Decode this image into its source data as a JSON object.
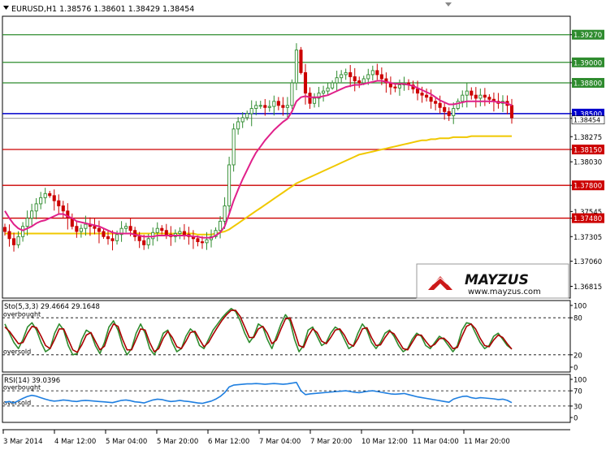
{
  "header": {
    "symbol_line": "EURUSD,H1  1.38576 1.38601 1.38429 1.38454"
  },
  "watermark": {
    "brand": "MAYZUS",
    "url": "www.mayzus.com"
  },
  "colors": {
    "green_line": "#2e8b2e",
    "red_line": "#cc0000",
    "blue_line": "#0000cc",
    "ma_fast": "#e0208a",
    "ma_slow": "#f0c800",
    "stoch_main": "#2e8b2e",
    "stoch_signal": "#aa0000",
    "rsi": "#1f7fe0"
  },
  "chart_data": [
    {
      "type": "candlestick",
      "title": "EURUSD,H1",
      "ohlc_last": {
        "open": 1.38576,
        "high": 1.38601,
        "low": 1.38429,
        "close": 1.38454
      },
      "ylim": [
        1.367,
        1.3945
      ],
      "y_ticks": [
        {
          "value": 1.3927,
          "label": "1.39270"
        },
        {
          "value": 1.39,
          "label": "1.39000"
        },
        {
          "value": 1.388,
          "label": "1.38800"
        },
        {
          "value": 1.385,
          "label": "1.38500"
        },
        {
          "value": 1.38454,
          "label": "1.38454"
        },
        {
          "value": 1.38275,
          "label": "1.38275"
        },
        {
          "value": 1.3815,
          "label": "1.38150"
        },
        {
          "value": 1.3803,
          "label": "1.38030"
        },
        {
          "value": 1.378,
          "label": "1.37800"
        },
        {
          "value": 1.37545,
          "label": "1.37545"
        },
        {
          "value": 1.3748,
          "label": "1.37480"
        },
        {
          "value": 1.373,
          "label": "1.37305"
        },
        {
          "value": 1.3706,
          "label": "1.37060"
        },
        {
          "value": 1.36815,
          "label": "1.36815"
        }
      ],
      "x_ticks": [
        "3 Mar 2014",
        "4 Mar 12:00",
        "5 Mar 04:00",
        "5 Mar 20:00",
        "6 Mar 12:00",
        "7 Mar 04:00",
        "7 Mar 20:00",
        "10 Mar 12:00",
        "11 Mar 04:00",
        "11 Mar 20:00"
      ],
      "horizontal_levels": [
        {
          "value": 1.3927,
          "label": "1.39270",
          "role": "resistance"
        },
        {
          "value": 1.39,
          "label": "1.39000",
          "role": "resistance"
        },
        {
          "value": 1.388,
          "label": "1.38800",
          "role": "resistance"
        },
        {
          "value": 1.385,
          "label": "1.38500",
          "role": "pivot"
        },
        {
          "value": 1.3815,
          "label": "1.38150",
          "role": "support"
        },
        {
          "value": 1.378,
          "label": "1.37800",
          "role": "support"
        },
        {
          "value": 1.3748,
          "label": "1.37480",
          "role": "support"
        }
      ],
      "close_series": [
        1.3735,
        1.3728,
        1.3722,
        1.373,
        1.374,
        1.3748,
        1.3755,
        1.3762,
        1.3768,
        1.3772,
        1.377,
        1.3765,
        1.376,
        1.3755,
        1.3748,
        1.374,
        1.3735,
        1.3738,
        1.3742,
        1.374,
        1.3738,
        1.3735,
        1.373,
        1.3728,
        1.3726,
        1.3732,
        1.3738,
        1.374,
        1.3736,
        1.373,
        1.3726,
        1.3722,
        1.3728,
        1.3734,
        1.3738,
        1.3736,
        1.3732,
        1.373,
        1.3733,
        1.3735,
        1.3732,
        1.373,
        1.3728,
        1.3725,
        1.3724,
        1.3727,
        1.373,
        1.3736,
        1.3745,
        1.376,
        1.38,
        1.3835,
        1.3842,
        1.3846,
        1.385,
        1.3855,
        1.3858,
        1.3858,
        1.3856,
        1.3857,
        1.3862,
        1.3858,
        1.3856,
        1.3858,
        1.388,
        1.3912,
        1.389,
        1.387,
        1.386,
        1.3865,
        1.387,
        1.3872,
        1.3875,
        1.388,
        1.3885,
        1.3888,
        1.389,
        1.3886,
        1.3882,
        1.388,
        1.3884,
        1.3888,
        1.3892,
        1.3888,
        1.3884,
        1.388,
        1.3876,
        1.3875,
        1.3878,
        1.388,
        1.3878,
        1.3874,
        1.387,
        1.3868,
        1.3866,
        1.3862,
        1.386,
        1.3856,
        1.3852,
        1.3848,
        1.3855,
        1.3862,
        1.3868,
        1.3872,
        1.3868,
        1.3865,
        1.3868,
        1.3866,
        1.3864,
        1.3862,
        1.386,
        1.3862,
        1.3858,
        1.3846
      ],
      "ma_fast": [
        1.3755,
        1.3748,
        1.3742,
        1.3738,
        1.3736,
        1.3738,
        1.374,
        1.3743,
        1.3745,
        1.3746,
        1.3748,
        1.375,
        1.3752,
        1.3752,
        1.375,
        1.3748,
        1.3745,
        1.3744,
        1.3743,
        1.3742,
        1.3741,
        1.374,
        1.3738,
        1.3736,
        1.3734,
        1.3733,
        1.3733,
        1.3733,
        1.3733,
        1.3732,
        1.3731,
        1.373,
        1.373,
        1.373,
        1.3731,
        1.3731,
        1.3731,
        1.3731,
        1.3731,
        1.3731,
        1.3731,
        1.3731,
        1.373,
        1.373,
        1.3729,
        1.3729,
        1.3729,
        1.3731,
        1.3734,
        1.374,
        1.3752,
        1.3765,
        1.3776,
        1.3786,
        1.3795,
        1.3804,
        1.3812,
        1.3818,
        1.3824,
        1.3829,
        1.3834,
        1.3838,
        1.3842,
        1.3845,
        1.3852,
        1.3862,
        1.3866,
        1.3867,
        1.3866,
        1.3866,
        1.3866,
        1.3867,
        1.3868,
        1.387,
        1.3872,
        1.3874,
        1.3876,
        1.3877,
        1.3878,
        1.3878,
        1.3879,
        1.388,
        1.3881,
        1.3882,
        1.3882,
        1.3881,
        1.388,
        1.3879,
        1.3879,
        1.3879,
        1.3878,
        1.3877,
        1.3875,
        1.3873,
        1.3871,
        1.3869,
        1.3866,
        1.3863,
        1.3861,
        1.3859,
        1.3859,
        1.386,
        1.3861,
        1.3862,
        1.3862,
        1.3862,
        1.3862,
        1.3862,
        1.3862,
        1.3862,
        1.3861,
        1.3861,
        1.386,
        1.3858
      ],
      "ma_slow": [
        1.3733,
        1.3733,
        1.3733,
        1.3733,
        1.3733,
        1.3733,
        1.3733,
        1.3733,
        1.3733,
        1.3733,
        1.3733,
        1.3733,
        1.3733,
        1.3733,
        1.3733,
        1.3733,
        1.3733,
        1.3733,
        1.3733,
        1.3733,
        1.3733,
        1.3733,
        1.3733,
        1.3733,
        1.3733,
        1.3733,
        1.3733,
        1.3733,
        1.3733,
        1.3733,
        1.3733,
        1.3733,
        1.3733,
        1.3733,
        1.3733,
        1.3733,
        1.3733,
        1.3733,
        1.3733,
        1.3733,
        1.3733,
        1.3733,
        1.3733,
        1.3732,
        1.3732,
        1.3732,
        1.3732,
        1.3733,
        1.3734,
        1.3735,
        1.3737,
        1.374,
        1.3743,
        1.3746,
        1.3749,
        1.3752,
        1.3755,
        1.3758,
        1.3761,
        1.3764,
        1.3767,
        1.377,
        1.3773,
        1.3776,
        1.3779,
        1.3782,
        1.3784,
        1.3786,
        1.3788,
        1.379,
        1.3792,
        1.3794,
        1.3796,
        1.3798,
        1.38,
        1.3802,
        1.3804,
        1.3806,
        1.3808,
        1.381,
        1.3811,
        1.3812,
        1.3813,
        1.3814,
        1.3815,
        1.3816,
        1.3817,
        1.3818,
        1.3819,
        1.382,
        1.3821,
        1.3822,
        1.3823,
        1.3824,
        1.3824,
        1.3825,
        1.3825,
        1.3826,
        1.3826,
        1.3826,
        1.3827,
        1.3827,
        1.3827,
        1.3827,
        1.3828,
        1.3828,
        1.3828,
        1.3828,
        1.3828,
        1.3828,
        1.3828,
        1.3828,
        1.3828,
        1.3828
      ]
    },
    {
      "type": "line",
      "title": "Sto(5,3,3) 29.4664 29.1648",
      "ylim": [
        0,
        100
      ],
      "levels": [
        {
          "value": 80,
          "label": "overbought"
        },
        {
          "value": 20,
          "label": "oversold"
        }
      ],
      "y_ticks": [
        "100",
        "80",
        "20",
        "0"
      ],
      "series": [
        {
          "name": "main",
          "values": [
            70,
            55,
            40,
            30,
            45,
            65,
            72,
            60,
            40,
            25,
            30,
            55,
            70,
            60,
            35,
            20,
            22,
            45,
            60,
            55,
            35,
            22,
            40,
            65,
            75,
            60,
            35,
            20,
            30,
            55,
            70,
            55,
            30,
            20,
            35,
            55,
            60,
            40,
            25,
            30,
            50,
            62,
            55,
            35,
            30,
            45,
            60,
            70,
            80,
            88,
            95,
            90,
            75,
            55,
            40,
            50,
            70,
            65,
            45,
            30,
            50,
            70,
            85,
            75,
            45,
            25,
            35,
            60,
            65,
            50,
            35,
            40,
            55,
            65,
            60,
            45,
            30,
            35,
            55,
            70,
            60,
            40,
            30,
            40,
            55,
            60,
            50,
            35,
            25,
            30,
            45,
            55,
            50,
            35,
            30,
            40,
            50,
            45,
            35,
            25,
            35,
            60,
            72,
            70,
            55,
            40,
            30,
            35,
            50,
            55,
            45,
            35,
            29.4664
          ]
        },
        {
          "name": "signal",
          "values": [
            65,
            58,
            48,
            38,
            40,
            55,
            66,
            64,
            50,
            35,
            30,
            45,
            62,
            62,
            45,
            28,
            24,
            36,
            52,
            56,
            42,
            28,
            34,
            55,
            70,
            66,
            45,
            28,
            28,
            45,
            62,
            60,
            40,
            25,
            30,
            47,
            58,
            48,
            33,
            30,
            42,
            56,
            58,
            45,
            33,
            40,
            53,
            65,
            76,
            85,
            92,
            92,
            82,
            65,
            48,
            48,
            62,
            66,
            55,
            38,
            44,
            62,
            78,
            80,
            58,
            35,
            32,
            50,
            62,
            56,
            42,
            38,
            48,
            60,
            62,
            52,
            38,
            34,
            46,
            62,
            64,
            48,
            35,
            36,
            48,
            58,
            54,
            42,
            30,
            28,
            40,
            52,
            52,
            42,
            33,
            37,
            46,
            47,
            40,
            30,
            32,
            50,
            66,
            70,
            62,
            47,
            35,
            33,
            44,
            52,
            48,
            38,
            29.1648
          ]
        }
      ]
    },
    {
      "type": "line",
      "title": "RSI(14) 39.0396",
      "ylim": [
        0,
        100
      ],
      "levels": [
        {
          "value": 70,
          "label": "overbought"
        },
        {
          "value": 30,
          "label": "oversold"
        }
      ],
      "y_ticks": [
        "100",
        "70",
        "30",
        "0"
      ],
      "series": [
        {
          "name": "RSI",
          "values": [
            40,
            42,
            38,
            44,
            50,
            55,
            58,
            56,
            52,
            48,
            45,
            43,
            44,
            46,
            45,
            43,
            42,
            44,
            45,
            44,
            43,
            42,
            41,
            40,
            39,
            42,
            45,
            46,
            44,
            41,
            40,
            38,
            42,
            46,
            48,
            47,
            44,
            42,
            43,
            45,
            43,
            42,
            40,
            38,
            37,
            40,
            43,
            48,
            55,
            65,
            80,
            85,
            86,
            87,
            88,
            88,
            89,
            88,
            87,
            88,
            89,
            88,
            87,
            88,
            90,
            92,
            70,
            60,
            62,
            63,
            64,
            65,
            66,
            67,
            68,
            69,
            70,
            68,
            66,
            65,
            67,
            69,
            70,
            68,
            66,
            64,
            62,
            61,
            62,
            63,
            60,
            57,
            54,
            52,
            50,
            48,
            46,
            44,
            42,
            40,
            48,
            52,
            55,
            56,
            52,
            50,
            52,
            51,
            50,
            49,
            47,
            48,
            45,
            39.0396
          ]
        }
      ]
    }
  ]
}
